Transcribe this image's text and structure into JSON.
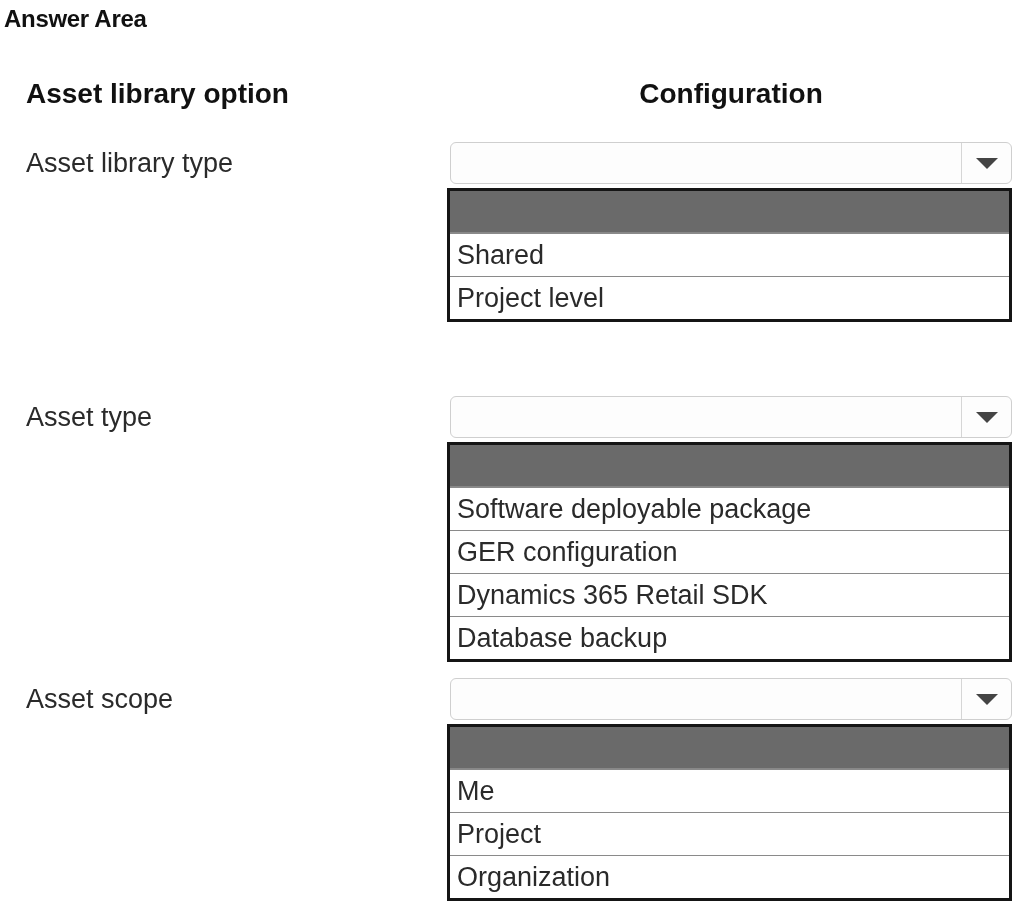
{
  "title": "Answer Area",
  "headers": {
    "option": "Asset library option",
    "configuration": "Configuration"
  },
  "rows": [
    {
      "label": "Asset library type",
      "dropdown": {
        "expanded": true,
        "blank_option_highlighted": true,
        "options": [
          {
            "label": "Shared",
            "selected": false
          },
          {
            "label": "Project level",
            "selected": false
          }
        ]
      }
    },
    {
      "label": "Asset type",
      "dropdown": {
        "expanded": true,
        "blank_option_highlighted": true,
        "options": [
          {
            "label": "Software deployable package",
            "selected": false
          },
          {
            "label": "GER configuration",
            "selected": false
          },
          {
            "label": "Dynamics 365 Retail SDK",
            "selected": false
          },
          {
            "label": "Database backup",
            "selected": false
          }
        ]
      }
    },
    {
      "label": "Asset scope",
      "dropdown": {
        "expanded": true,
        "blank_option_highlighted": true,
        "options": [
          {
            "label": "Me",
            "selected": false
          },
          {
            "label": "Project",
            "selected": false
          },
          {
            "label": "Organization",
            "selected": false
          }
        ]
      }
    }
  ]
}
